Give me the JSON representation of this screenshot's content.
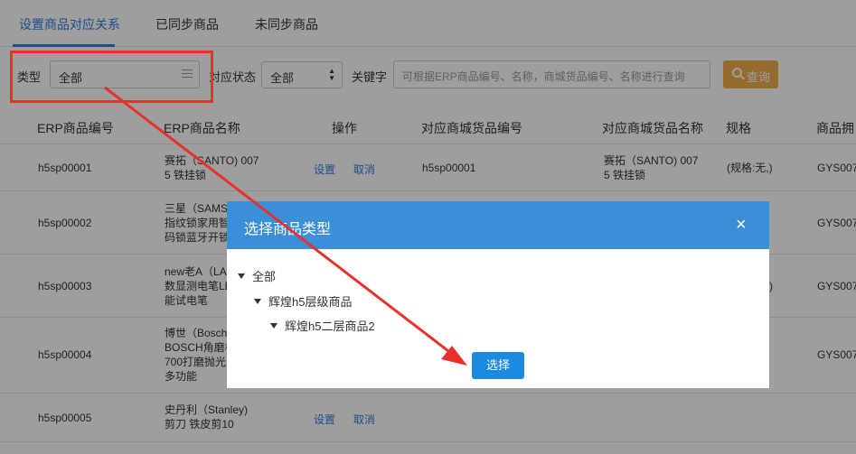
{
  "tabs": [
    {
      "label": "设置商品对应关系"
    },
    {
      "label": "已同步商品"
    },
    {
      "label": "未同步商品"
    }
  ],
  "filters": {
    "type_label": "类型",
    "type_value": "全部",
    "status_label": "对应状态",
    "status_value": "全部",
    "keyword_label": "关键字",
    "keyword_placeholder": "可根据ERP商品编号、名称，商城货品编号、名称进行查询",
    "query_label": "查询"
  },
  "table": {
    "headers": [
      "ERP商品编号",
      "ERP商品名称",
      "操作",
      "对应商城货品编号",
      "对应商城货品名称",
      "规格",
      "商品拥"
    ],
    "rows": [
      {
        "code": "h5sp00001",
        "name": [
          "赛拓（SANTO) 007",
          "5 铁挂锁"
        ],
        "actions": [
          "设置",
          "取消"
        ],
        "mall_code": "h5sp00001",
        "mall_name": [
          "赛拓（SANTO) 007",
          "5 铁挂锁"
        ],
        "spec": "(规格:无,)",
        "owner": "GYS007"
      },
      {
        "code": "h5sp00002",
        "name": [
          "三星（SAMS",
          "指纹锁家用智",
          "码锁蓝牙开锁"
        ],
        "actions": [],
        "mall_code": "",
        "mall_name": [],
        "spec": "",
        "owner": "GYS007"
      },
      {
        "code": "h5sp00003",
        "name": [
          "new老A（LA",
          "数显测电笔LE",
          "能试电笔"
        ],
        "actions": [],
        "mall_code": "",
        "mall_name": [],
        "spec": ")",
        "owner": "GYS007"
      },
      {
        "code": "h5sp00004",
        "name": [
          "博世（Bosch",
          "BOSCH角磨机",
          "700打磨抛光",
          "多功能"
        ],
        "actions": [],
        "mall_code": "",
        "mall_name": [],
        "spec": "",
        "owner": "GYS007"
      },
      {
        "code": "h5sp00005",
        "name": [
          "史丹利（Stanley)",
          "剪刀 铁皮剪10"
        ],
        "actions": [
          "设置",
          "取消"
        ],
        "mall_code": "",
        "mall_name": [],
        "spec": "",
        "owner": ""
      }
    ]
  },
  "modal": {
    "title": "选择商品类型",
    "close": "×",
    "tree": [
      "全部",
      "辉煌h5层级商品",
      "辉煌h5二层商品2"
    ],
    "select_label": "选择"
  },
  "colors": {
    "accent": "#2f7ed8",
    "modal_header": "#3a8fd8",
    "query_button": "#f0ad4e",
    "select_button": "#1b8be0",
    "annotation_red": "#e8312a"
  },
  "icons": [
    "list-icon",
    "sort-arrows-icon",
    "search-icon",
    "close-icon",
    "caret-down-icon"
  ]
}
